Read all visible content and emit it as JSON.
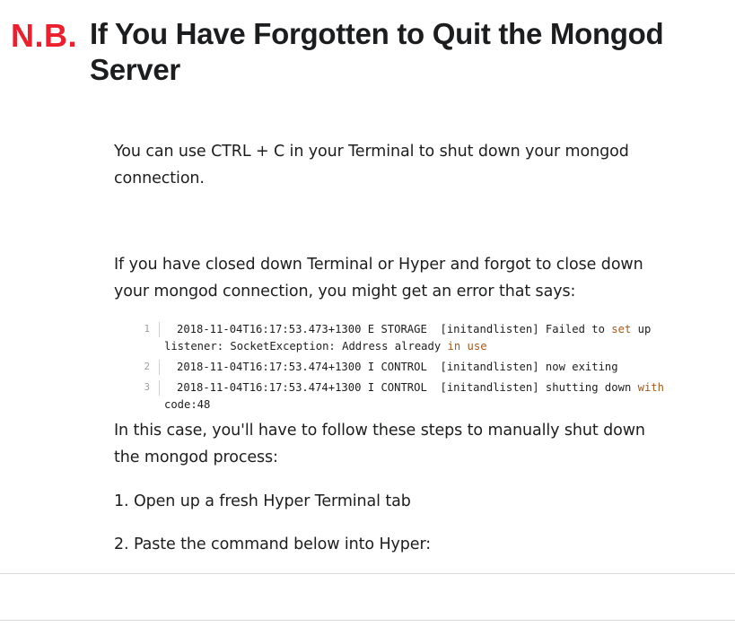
{
  "heading": {
    "badge": "N.B.",
    "title": "If You Have Forgotten to Quit the Mongod Server"
  },
  "paragraphs": {
    "p1": "You can use CTRL + C in your Terminal to shut down your mongod connection.",
    "p2": "If you have closed down Terminal or Hyper and forgot to close down your mongod connection, you might get an error that says:",
    "p3": "In this case, you'll have to follow these steps to manually shut down the mongod process:",
    "step1": "1. Open up a fresh Hyper Terminal tab",
    "step2": "2. Paste the command below into Hyper:"
  },
  "code": {
    "lines": [
      {
        "num": "1",
        "segments": [
          {
            "text": "2018-11-04T16:17:53.473+1300 E STORAGE  [initandlisten] Failed to ",
            "kw": false
          },
          {
            "text": "set",
            "kw": true
          },
          {
            "text": " up listener: SocketException: Address already ",
            "kw": false
          },
          {
            "text": "in use",
            "kw": true
          }
        ]
      },
      {
        "num": "2",
        "segments": [
          {
            "text": "2018-11-04T16:17:53.474+1300 I CONTROL  [initandlisten] now exiting",
            "kw": false
          }
        ]
      },
      {
        "num": "3",
        "segments": [
          {
            "text": "2018-11-04T16:17:53.474+1300 I CONTROL  [initandlisten] shutting down ",
            "kw": false
          },
          {
            "text": "with",
            "kw": true
          },
          {
            "text": " code:48",
            "kw": false
          }
        ]
      }
    ]
  },
  "colors": {
    "badge": "#ec1f2d",
    "text": "#1c1d1f",
    "keyword": "#a35a1c",
    "line_number": "#9a9a9a"
  }
}
